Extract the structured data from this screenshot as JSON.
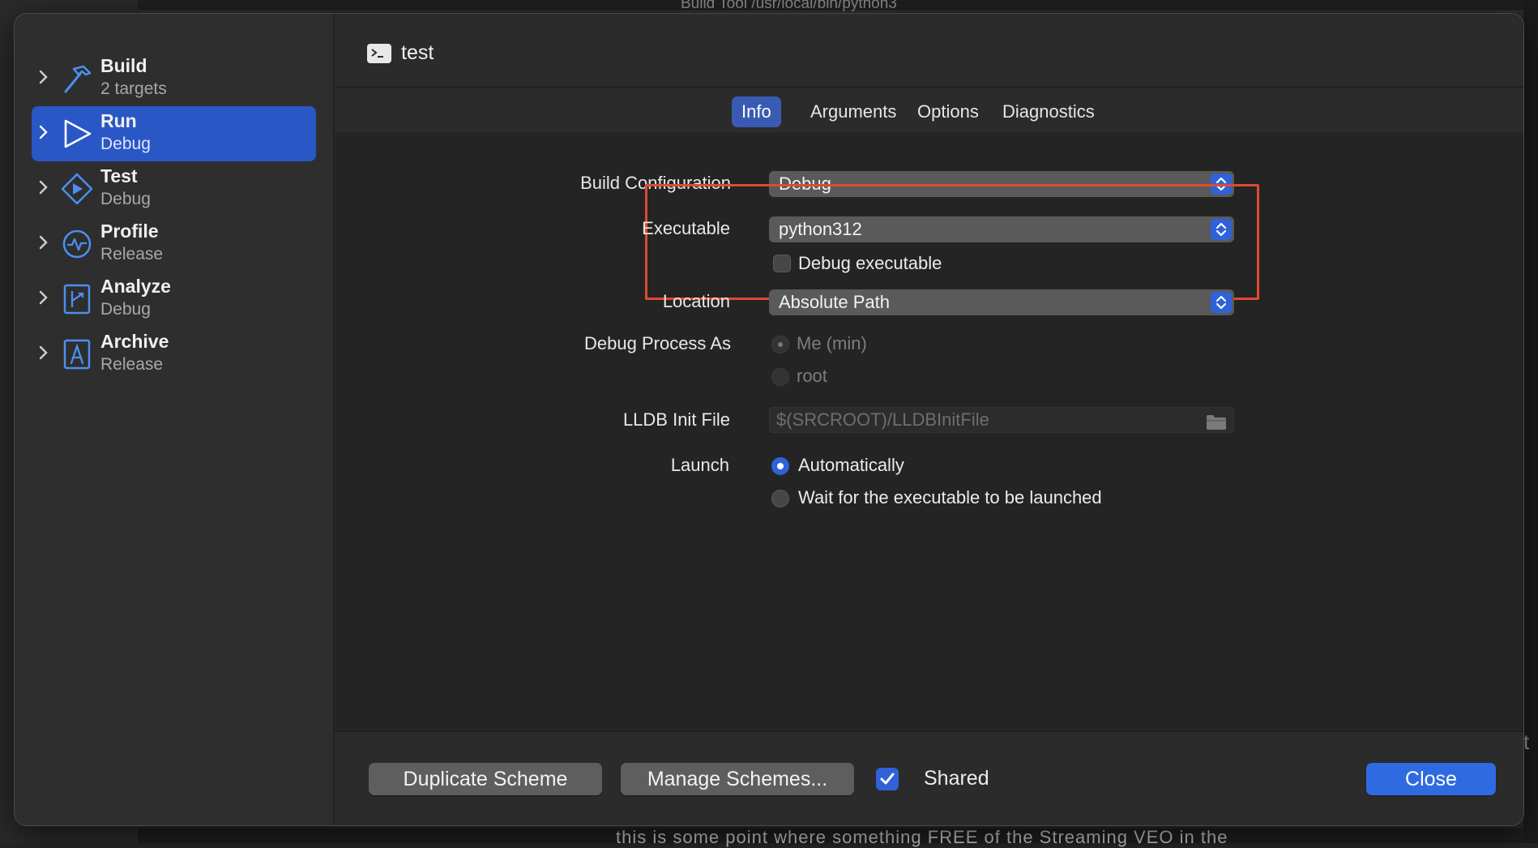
{
  "background": {
    "top_text": "Build Tool  /usr/local/bin/python3",
    "bottom_text": "this is some point where something FREE of the Streaming VEO in the",
    "right_glyph": "t"
  },
  "sidebar": {
    "items": [
      {
        "title": "Build",
        "subtitle": "2 targets",
        "icon": "hammer-icon",
        "selected": false
      },
      {
        "title": "Run",
        "subtitle": "Debug",
        "icon": "play-icon",
        "selected": true
      },
      {
        "title": "Test",
        "subtitle": "Debug",
        "icon": "test-diamond-icon",
        "selected": false
      },
      {
        "title": "Profile",
        "subtitle": "Release",
        "icon": "profile-gauge-icon",
        "selected": false
      },
      {
        "title": "Analyze",
        "subtitle": "Debug",
        "icon": "analyze-icon",
        "selected": false
      },
      {
        "title": "Archive",
        "subtitle": "Release",
        "icon": "archive-icon",
        "selected": false
      }
    ]
  },
  "header": {
    "title": "test",
    "icon": "terminal-icon"
  },
  "tabs": [
    {
      "label": "Info",
      "active": true
    },
    {
      "label": "Arguments",
      "active": false
    },
    {
      "label": "Options",
      "active": false
    },
    {
      "label": "Diagnostics",
      "active": false
    }
  ],
  "form": {
    "build_configuration": {
      "label": "Build Configuration",
      "value": "Debug"
    },
    "executable": {
      "label": "Executable",
      "value": "python312"
    },
    "debug_executable": {
      "label": "Debug executable",
      "checked": false
    },
    "location": {
      "label": "Location",
      "value": "Absolute Path"
    },
    "debug_process_as": {
      "label": "Debug Process As",
      "options": [
        "Me (min)",
        "root"
      ],
      "selected": "Me (min)",
      "enabled": false
    },
    "lldb_init_file": {
      "label": "LLDB Init File",
      "placeholder": "$(SRCROOT)/LLDBInitFile"
    },
    "launch": {
      "label": "Launch",
      "options": [
        "Automatically",
        "Wait for the executable to be launched"
      ],
      "selected": "Automatically"
    }
  },
  "footer": {
    "duplicate_label": "Duplicate Scheme",
    "manage_label": "Manage Schemes...",
    "shared_label": "Shared",
    "shared_checked": true,
    "close_label": "Close"
  },
  "colors": {
    "accent": "#2f62d8",
    "selection": "#2a57c6",
    "highlight_box": "#e04a32"
  }
}
